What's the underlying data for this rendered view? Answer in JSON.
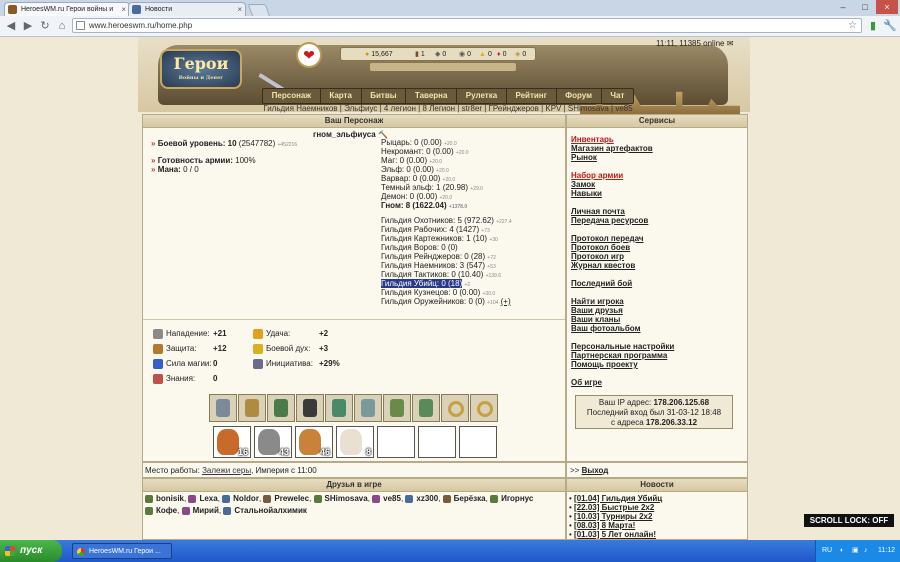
{
  "browser": {
    "tabs": [
      {
        "label": "HeroesWM.ru Герои войны и",
        "active": true
      },
      {
        "label": "Новости",
        "active": false
      }
    ],
    "url": "www.heroeswm.ru/home.php"
  },
  "header": {
    "logo_text": "Герои",
    "logo_sub": "Войны и Денег",
    "time_online": "11:11, 11385 online",
    "resources": [
      {
        "icon": "gold-icon",
        "value": "15,667"
      },
      {
        "icon": "wood-icon",
        "value": "1"
      },
      {
        "icon": "ore-icon",
        "value": "0"
      },
      {
        "icon": "mercury-icon",
        "value": "0"
      },
      {
        "icon": "sulfur-icon",
        "value": "0"
      },
      {
        "icon": "crystal-icon",
        "value": "0"
      },
      {
        "icon": "gem-icon",
        "value": "0"
      }
    ]
  },
  "menu": [
    "Персонаж",
    "Карта",
    "Битвы",
    "Таверна",
    "Рулетка",
    "Рейтинг",
    "Форум",
    "Чат"
  ],
  "guild_links": "Гильдия Наемников | Эльфиус | 4 легион | 8 Легион | str8er | ГРейнджеров | KPV | SHimosava | ve85",
  "character": {
    "panel_title": "Ваш Персонаж",
    "name": "гном_эльфиуса",
    "combat_level_label": "Боевой уровень:",
    "combat_level": "10",
    "combat_exp": "(2547782)",
    "combat_exp_small": "+452216",
    "army_label": "Готовность армии:",
    "army_value": "100%",
    "mana_label": "Мана:",
    "mana_value": "0 / 0",
    "factions": [
      {
        "text": "Рыцарь: 0 (0.00)",
        "small": "+20.0",
        "bold": false
      },
      {
        "text": "Некромант: 0 (0.00)",
        "small": "+20.0",
        "bold": false
      },
      {
        "text": "Маг: 0 (0.00)",
        "small": "+20.0",
        "bold": false
      },
      {
        "text": "Эльф: 0 (0.00)",
        "small": "+20.0",
        "bold": false
      },
      {
        "text": "Варвар: 0 (0.00)",
        "small": "+20.0",
        "bold": false
      },
      {
        "text": "Темный эльф: 1 (20.98)",
        "small": "+29.0",
        "bold": false
      },
      {
        "text": "Демон: 0 (0.00)",
        "small": "+20.0",
        "bold": false
      },
      {
        "text": "Гном: 8 (1622.04)",
        "small": "+1378.0",
        "bold": true
      }
    ],
    "guilds": [
      {
        "text": "Гильдия Охотников: 5 (972.62)",
        "small": "+227.4",
        "hl": false
      },
      {
        "text": "Гильдия Рабочих: 4 (1427)",
        "small": "+73",
        "hl": false
      },
      {
        "text": "Гильдия Картежников: 1 (10)",
        "small": "+30",
        "hl": false
      },
      {
        "text": "Гильдия Воров: 0 (0)",
        "small": "",
        "hl": false
      },
      {
        "text": "Гильдия Рейнджеров: 0 (28)",
        "small": "+72",
        "hl": false
      },
      {
        "text": "Гильдия Наемников: 3 (547)",
        "small": "+53",
        "hl": false
      },
      {
        "text": "Гильдия Тактиков: 0 (10.40)",
        "small": "+139.6",
        "hl": false
      },
      {
        "text": "Гильдия Убийц: 0 (18)",
        "small": "+2",
        "hl": true
      },
      {
        "text": "Гильдия Кузнецов: 0 (0.00)",
        "small": "+30.0",
        "hl": false
      },
      {
        "text": "Гильдия Оружейников: 0 (0)",
        "small": "+104",
        "hl": false
      }
    ],
    "guild_plus": "(+)",
    "stats": [
      {
        "icon": "attack-icon",
        "label": "Нападение:",
        "value": "+21"
      },
      {
        "icon": "defense-icon",
        "label": "Защита:",
        "value": "+12"
      },
      {
        "icon": "magic-power-icon",
        "label": "Сила магии:",
        "value": "0"
      },
      {
        "icon": "knowledge-icon",
        "label": "Знания:",
        "value": "0"
      }
    ],
    "stats2": [
      {
        "icon": "luck-icon",
        "label": "Удача:",
        "value": "+2"
      },
      {
        "icon": "morale-icon",
        "label": "Боевой дух:",
        "value": "+3"
      },
      {
        "icon": "initiative-icon",
        "label": "Инициатива:",
        "value": "+29%"
      }
    ],
    "artifacts": [
      "helmet-icon",
      "amulet-icon",
      "armor-icon",
      "cloak-icon",
      "bow-icon",
      "sword-icon",
      "shield-icon",
      "boots-icon",
      "ring-icon",
      "ring-icon"
    ],
    "units": [
      "16",
      "43",
      "46",
      "8",
      "",
      "",
      ""
    ],
    "work_label": "Место работы:",
    "work_place": "Залежи серы",
    "work_rest": ", Империя с 11:00"
  },
  "services": {
    "title": "Сервисы",
    "groups": [
      [
        {
          "label": "Инвентарь",
          "red": true
        },
        {
          "label": "Магазин артефактов"
        },
        {
          "label": "Рынок"
        }
      ],
      [
        {
          "label": "Набор армии",
          "red": true
        },
        {
          "label": "Замок"
        },
        {
          "label": "Навыки"
        }
      ],
      [
        {
          "label": "Личная почта"
        },
        {
          "label": "Передача ресурсов"
        }
      ],
      [
        {
          "label": "Протокол передач"
        },
        {
          "label": "Протокол боев"
        },
        {
          "label": "Протокол игр"
        },
        {
          "label": "Журнал квестов"
        }
      ],
      [
        {
          "label": "Последний бой"
        }
      ],
      [
        {
          "label": "Найти игрока"
        },
        {
          "label": "Ваши друзья"
        },
        {
          "label": "Ваши кланы"
        },
        {
          "label": "Ваш фотоальбом"
        }
      ],
      [
        {
          "label": "Персональные настройки"
        },
        {
          "label": "Партнерская программа"
        },
        {
          "label": "Помощь проекту"
        }
      ],
      [
        {
          "label": "Об игре"
        }
      ]
    ],
    "ip_label": "Ваш IP адрес:",
    "ip": "178.206.125.68",
    "last_login": "Последний вход был 31-03-12 18:48",
    "from_label": "с адреса",
    "from_ip": "178.206.33.12",
    "exit_prefix": ">>",
    "exit": "Выход"
  },
  "friends": {
    "title": "Друзья в игре",
    "line1": [
      "bonisik",
      "Lexa",
      "Noldor",
      "Prewelec",
      "SHimosava",
      "ve85",
      "xz300",
      "Берёзка",
      "Игорнус"
    ],
    "line2": [
      "Кофе",
      "Мирий",
      "Стальнойалхимик"
    ]
  },
  "news": {
    "title": "Новости",
    "items": [
      {
        "date": "[01.04]",
        "text": "Гильдия Убийц"
      },
      {
        "date": "[22.03]",
        "text": "Быстрые 2х2"
      },
      {
        "date": "[10.03]",
        "text": "Турниры 2х2"
      },
      {
        "date": "[08.03]",
        "text": "8 Марта!"
      },
      {
        "date": "[01.03]",
        "text": "5 Лет онлайн!"
      }
    ]
  },
  "overlay": {
    "scroll_lock": "SCROLL LOCK: OFF"
  },
  "taskbar": {
    "start": "пуск",
    "task": "HeroesWM.ru Герои ...",
    "lang": "RU",
    "clock": "11:12"
  }
}
